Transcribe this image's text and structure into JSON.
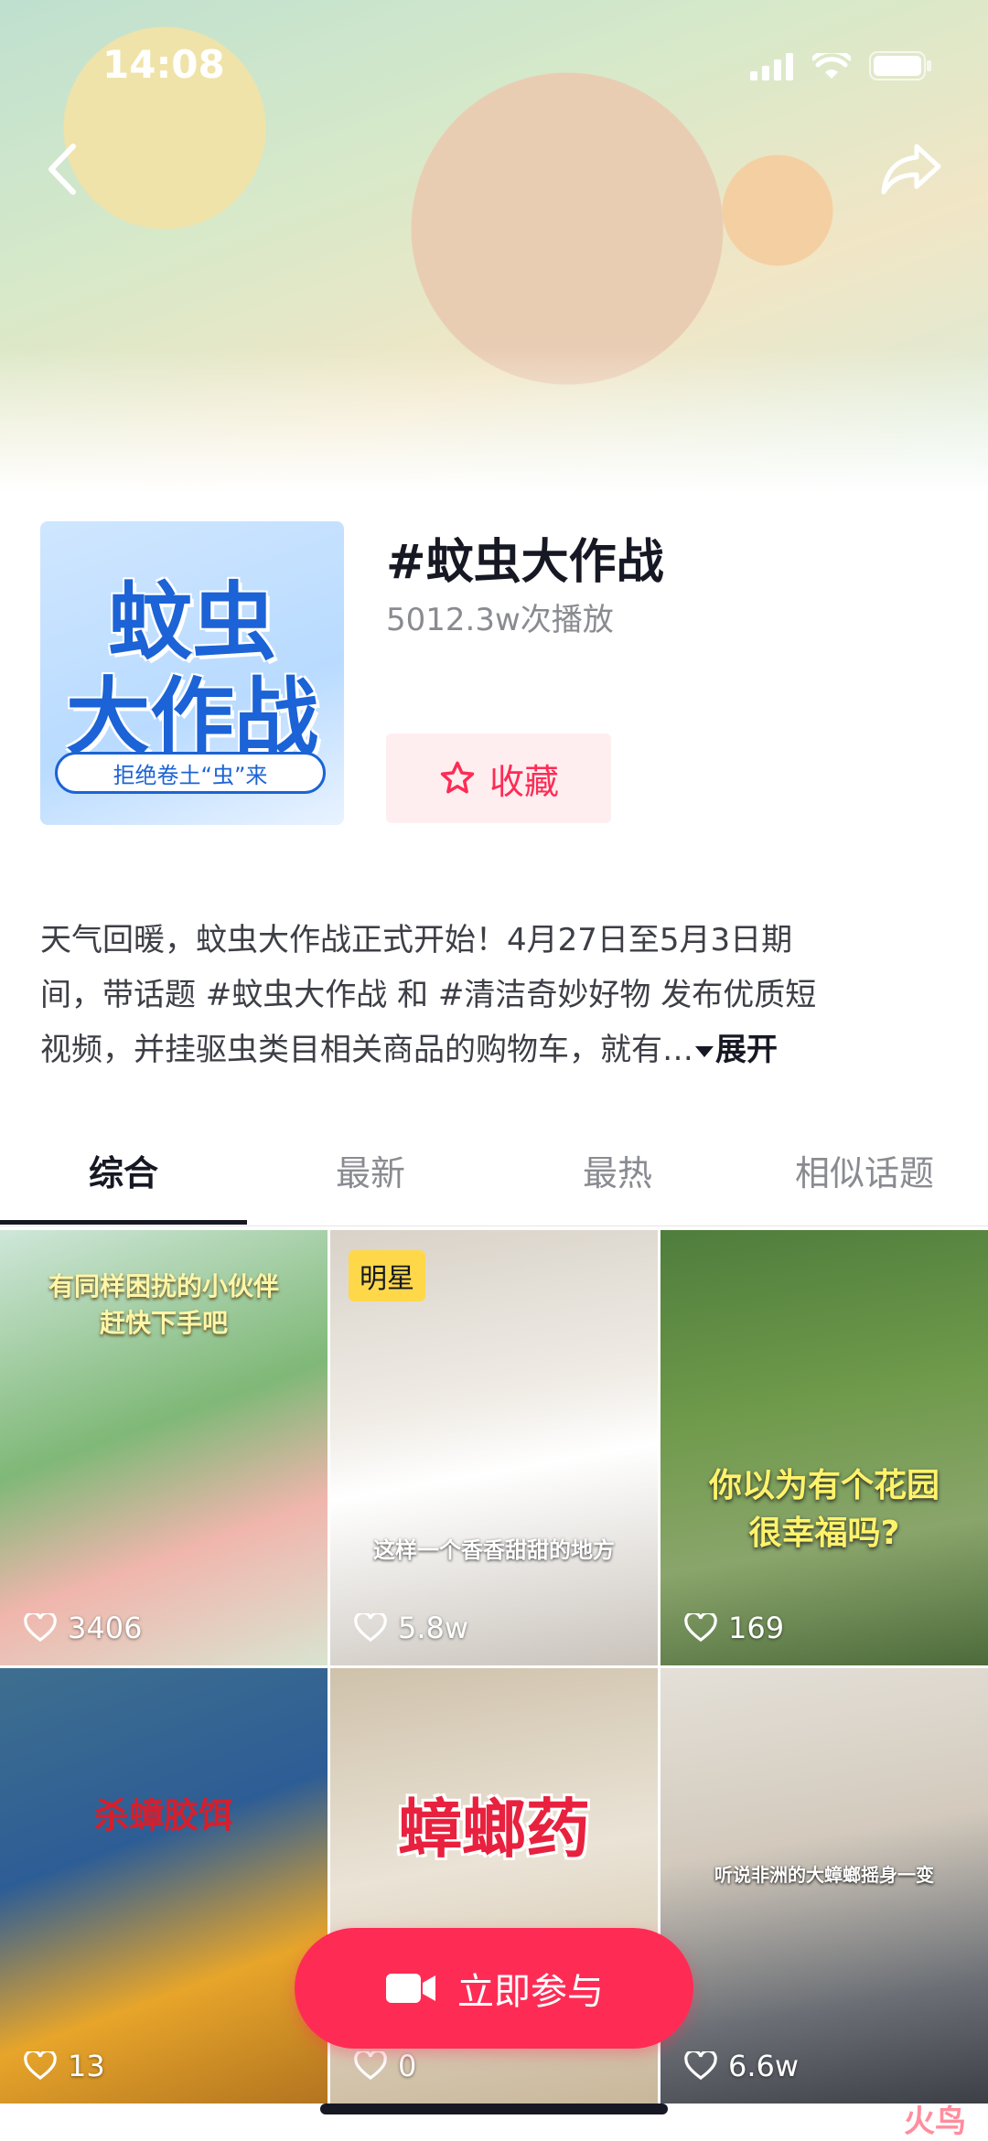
{
  "status_bar": {
    "time": "14:08"
  },
  "topic": {
    "title": "#蚊虫大作战",
    "plays": "5012.3w次播放",
    "cover": {
      "line1": "蚊虫",
      "line2": "大作战",
      "tagline": "拒绝卷土“虫”来"
    },
    "favorite_label": "收藏"
  },
  "description": {
    "line1": "天气回暖，蚊虫大作战正式开始！4月27日至5月3日期",
    "line2": "间，带话题 #蚊虫大作战 和 #清洁奇妙好物 发布优质短",
    "line3": "视频，并挂驱虫类目相关商品的购物车，就有…",
    "expand_label": "展开"
  },
  "tabs": [
    {
      "label": "综合",
      "active": true
    },
    {
      "label": "最新",
      "active": false
    },
    {
      "label": "最热",
      "active": false
    },
    {
      "label": "相似话题",
      "active": false
    }
  ],
  "videos": [
    {
      "likes": "3406",
      "caption": "有同样困扰的小伙伴\n赶快下手吧"
    },
    {
      "likes": "5.8w",
      "badge": "明星",
      "caption": "这样一个香香甜甜的地方"
    },
    {
      "likes": "169",
      "caption": "你以为有个花园\n很幸福吗?"
    },
    {
      "likes": "13",
      "caption": "杀蟑胶饵"
    },
    {
      "likes": "0",
      "caption": "蟑螂药"
    },
    {
      "likes": "6.6w",
      "caption": "听说非洲的大蟑螂摇身一变"
    }
  ],
  "join_button": {
    "label": "立即参与"
  },
  "watermark": "火鸟"
}
